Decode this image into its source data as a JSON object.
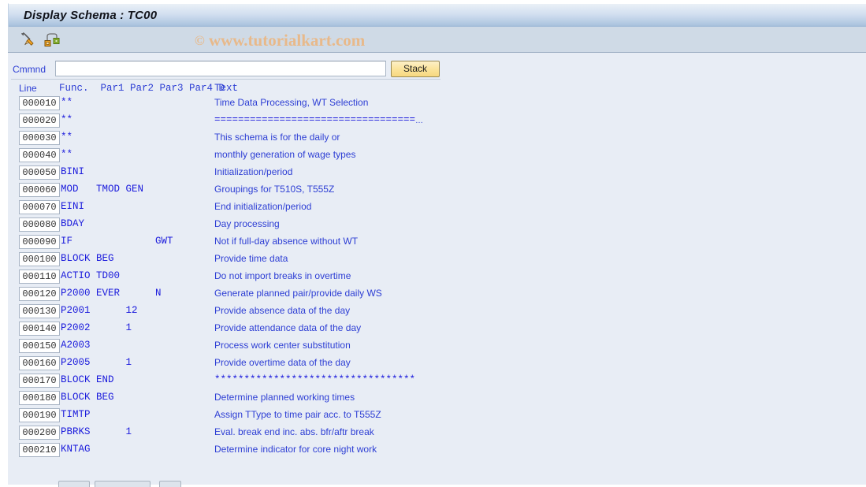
{
  "window": {
    "title": "Display Schema : TC00"
  },
  "toolbar": {
    "icons": [
      {
        "name": "check-pencil-icon",
        "title": "Check"
      },
      {
        "name": "schema-hierarchy-icon",
        "title": "Component"
      }
    ]
  },
  "watermark": {
    "copyright": "©",
    "text": "www.tutorialkart.com"
  },
  "command": {
    "label": "Cmmnd",
    "value": "",
    "placeholder": "",
    "stack_label": "Stack"
  },
  "table": {
    "headers": {
      "line": "Line",
      "func": "Func.",
      "par1": "Par1",
      "par2": "Par2",
      "par3": "Par3",
      "par4": "Par4",
      "d": "D",
      "text": "Text"
    },
    "header_mono": "Func.  Par1 Par2 Par3 Par4 D",
    "header_text": "Text",
    "rows": [
      {
        "line": "000010",
        "code": "**",
        "text": "Time Data Processing, WT Selection",
        "mono": false
      },
      {
        "line": "000020",
        "code": "**",
        "text": "==================================",
        "mono": true,
        "ellipsis": true
      },
      {
        "line": "000030",
        "code": "**",
        "text": "This schema is for the daily or",
        "mono": false
      },
      {
        "line": "000040",
        "code": "**",
        "text": "monthly generation of wage types",
        "mono": false
      },
      {
        "line": "000050",
        "code": "BINI",
        "text": "Initialization/period",
        "mono": false
      },
      {
        "line": "000060",
        "code": "MOD   TMOD GEN",
        "text": "Groupings for T510S, T555Z",
        "mono": false
      },
      {
        "line": "000070",
        "code": "EINI",
        "text": "End initialization/period",
        "mono": false
      },
      {
        "line": "000080",
        "code": "BDAY",
        "text": "Day processing",
        "mono": false
      },
      {
        "line": "000090",
        "code": "IF              GWT",
        "text": "Not if full-day absence without WT",
        "mono": false
      },
      {
        "line": "000100",
        "code": "BLOCK BEG",
        "text": "Provide time data",
        "mono": false
      },
      {
        "line": "000110",
        "code": "ACTIO TD00",
        "text": "Do not import breaks in overtime",
        "mono": false
      },
      {
        "line": "000120",
        "code": "P2000 EVER      N",
        "text": "Generate planned pair/provide daily WS",
        "mono": false
      },
      {
        "line": "000130",
        "code": "P2001      12",
        "text": "Provide absence data of the day",
        "mono": false
      },
      {
        "line": "000140",
        "code": "P2002      1",
        "text": "Provide attendance data of the day",
        "mono": false
      },
      {
        "line": "000150",
        "code": "A2003",
        "text": "Process work center substitution",
        "mono": false
      },
      {
        "line": "000160",
        "code": "P2005      1",
        "text": "Provide overtime data of the day",
        "mono": false
      },
      {
        "line": "000170",
        "code": "BLOCK END",
        "text": "**********************************",
        "mono": true
      },
      {
        "line": "000180",
        "code": "BLOCK BEG",
        "text": "Determine planned working times",
        "mono": false
      },
      {
        "line": "000190",
        "code": "TIMTP",
        "text": "Assign TType to time pair acc. to T555Z",
        "mono": false
      },
      {
        "line": "000200",
        "code": "PBRKS      1",
        "text": "Eval. break end inc. abs. bfr/aftr break",
        "mono": false
      },
      {
        "line": "000210",
        "code": "KNTAG",
        "text": "Determine indicator for core night work",
        "mono": false
      }
    ]
  },
  "bottom_buttons": [
    {
      "name": "bottom-button-1"
    },
    {
      "name": "bottom-button-2"
    },
    {
      "name": "bottom-button-3"
    }
  ],
  "colors": {
    "titlebar_accent": "#aec6e0",
    "toolbar_bg": "#cfdae6",
    "content_bg": "#e8edf5",
    "label_blue": "#2d3ed4",
    "code_blue": "#1b1bdc",
    "stack_yellow": "#fbe49c",
    "watermark_tan": "#e8b98a"
  }
}
